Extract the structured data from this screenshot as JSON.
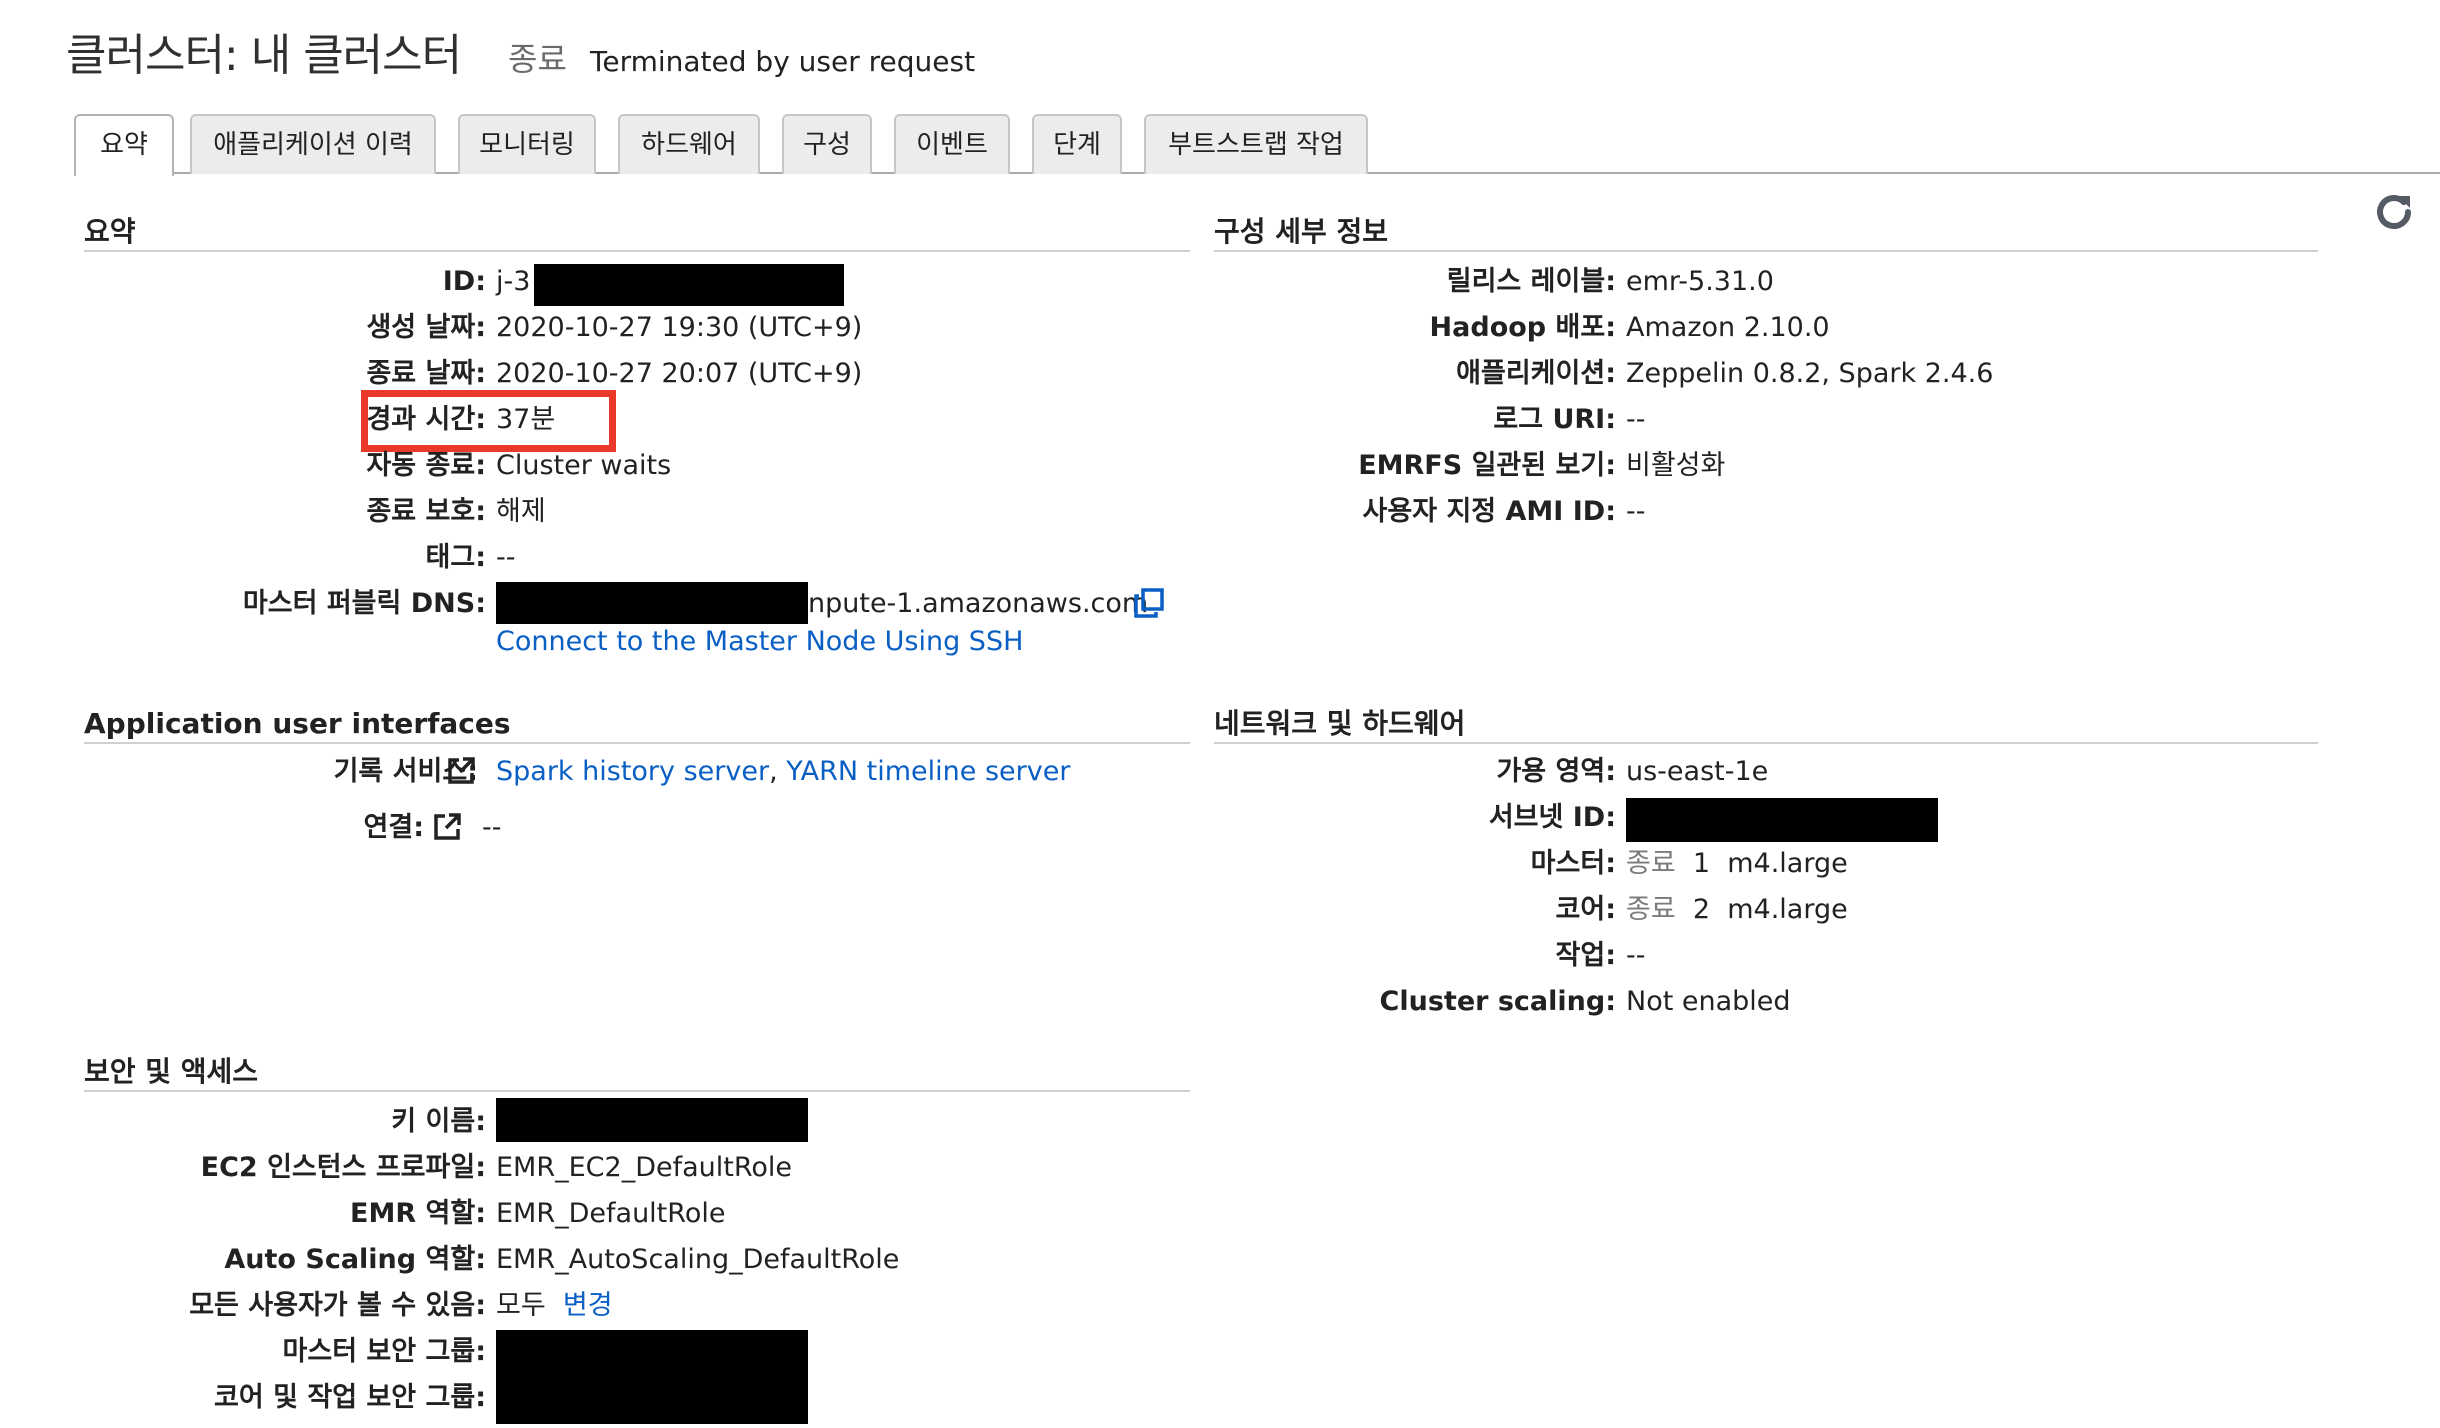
{
  "header": {
    "title": "클러스터: 내 클러스터",
    "status": "종료",
    "status_reason": "Terminated by user request"
  },
  "tabs": [
    {
      "label": "요약",
      "active": true
    },
    {
      "label": "애플리케이션 이력"
    },
    {
      "label": "모니터링"
    },
    {
      "label": "하드웨어"
    },
    {
      "label": "구성"
    },
    {
      "label": "이벤트"
    },
    {
      "label": "단계"
    },
    {
      "label": "부트스트랩 작업"
    }
  ],
  "summary": {
    "title": "요약",
    "id_label": "ID:",
    "id_value": "j-3",
    "created_label": "생성 날짜:",
    "created_value": "2020-10-27 19:30 (UTC+9)",
    "ended_label": "종료 날짜:",
    "ended_value": "2020-10-27 20:07 (UTC+9)",
    "elapsed_label": "경과 시간:",
    "elapsed_value": "37분",
    "auto_term_label": "자동 종료:",
    "auto_term_value": "Cluster waits",
    "term_protect_label": "종료 보호:",
    "term_protect_value": "해제",
    "tags_label": "태그:",
    "tags_value": "--",
    "dns_label": "마스터 퍼블릭 DNS:",
    "dns_value": "npute-1.amazonaws.com",
    "ssh_link": "Connect to the Master Node Using SSH"
  },
  "config": {
    "title": "구성 세부 정보",
    "release_label": "릴리스 레이블:",
    "release_value": "emr-5.31.0",
    "hadoop_label": "Hadoop 배포:",
    "hadoop_value": "Amazon 2.10.0",
    "apps_label": "애플리케이션:",
    "apps_value": "Zeppelin 0.8.2, Spark 2.4.6",
    "log_label": "로그 URI:",
    "log_value": "--",
    "emrfs_label": "EMRFS 일관된 보기:",
    "emrfs_value": "비활성화",
    "ami_label": "사용자 지정 AMI ID:",
    "ami_value": "--"
  },
  "app_ui": {
    "title": "Application user interfaces",
    "history_label": "기록 서비스:",
    "spark_link": "Spark history server",
    "sep": ", ",
    "yarn_link": "YARN timeline server",
    "conn_label": "연결:",
    "conn_value": "--"
  },
  "network": {
    "title": "네트워크 및 하드웨어",
    "az_label": "가용 영역:",
    "az_value": "us-east-1e",
    "subnet_label": "서브넷 ID:",
    "master_label": "마스터:",
    "master_state": "종료",
    "master_count": "1",
    "master_type": "m4.large",
    "core_label": "코어:",
    "core_state": "종료",
    "core_count": "2",
    "core_type": "m4.large",
    "task_label": "작업:",
    "task_value": "--",
    "scaling_label": "Cluster scaling:",
    "scaling_value": "Not enabled"
  },
  "security": {
    "title": "보안 및 액세스",
    "key_label": "키 이름:",
    "ec2_label": "EC2 인스턴스 프로파일:",
    "ec2_value": "EMR_EC2_DefaultRole",
    "emr_label": "EMR 역할:",
    "emr_value": "EMR_DefaultRole",
    "autoscale_label": "Auto Scaling 역할:",
    "autoscale_value": "EMR_AutoScaling_DefaultRole",
    "visible_label": "모든 사용자가 볼 수 있음:",
    "visible_value": "모두",
    "change_link": "변경",
    "master_sg_label": "마스터 보안 그룹:",
    "core_sg_label": "코어 및 작업 보안 그룹:"
  },
  "colors": {
    "link": "#0a5fc5",
    "highlight": "#e8392b",
    "status_muted": "#7a7a7a"
  },
  "icons": [
    "refresh-icon",
    "external-link-icon",
    "copy-icon"
  ]
}
